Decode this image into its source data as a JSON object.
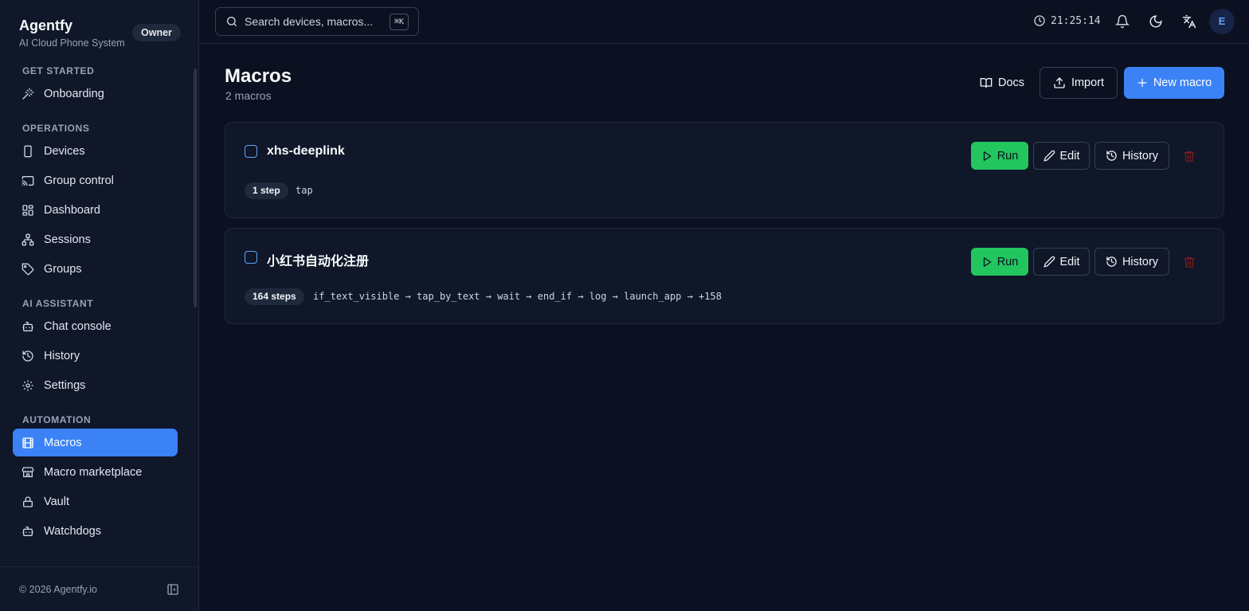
{
  "brand": {
    "name": "Agentfy",
    "subtitle": "AI Cloud Phone System",
    "role_badge": "Owner"
  },
  "sidebar": {
    "sections": [
      {
        "title": "GET STARTED",
        "items": [
          {
            "label": "Onboarding",
            "icon": "wand-icon"
          }
        ]
      },
      {
        "title": "OPERATIONS",
        "items": [
          {
            "label": "Devices",
            "icon": "smartphone-icon"
          },
          {
            "label": "Group control",
            "icon": "cast-icon"
          },
          {
            "label": "Dashboard",
            "icon": "grid-icon"
          },
          {
            "label": "Sessions",
            "icon": "network-icon"
          },
          {
            "label": "Groups",
            "icon": "tag-icon"
          }
        ]
      },
      {
        "title": "AI ASSISTANT",
        "items": [
          {
            "label": "Chat console",
            "icon": "bot-icon"
          },
          {
            "label": "History",
            "icon": "history-icon"
          },
          {
            "label": "Settings",
            "icon": "gear-icon"
          }
        ]
      },
      {
        "title": "AUTOMATION",
        "items": [
          {
            "label": "Macros",
            "icon": "film-icon",
            "active": true
          },
          {
            "label": "Macro marketplace",
            "icon": "store-icon"
          },
          {
            "label": "Vault",
            "icon": "lock-icon"
          },
          {
            "label": "Watchdogs",
            "icon": "bot-icon"
          }
        ]
      }
    ],
    "footer": {
      "copyright": "© 2026 Agentfy.io"
    }
  },
  "topbar": {
    "search_placeholder": "Search devices, macros...",
    "shortcut": "⌘K",
    "time": "21:25:14",
    "avatar_initial": "E"
  },
  "page": {
    "title": "Macros",
    "subtitle": "2 macros",
    "docs_label": "Docs",
    "import_label": "Import",
    "new_label": "New macro"
  },
  "macros": [
    {
      "name": "xhs-deeplink",
      "steps_badge": "1 step",
      "sequence": "tap"
    },
    {
      "name": "小红书自动化注册",
      "steps_badge": "164 steps",
      "sequence": "if_text_visible → tap_by_text → wait → end_if → log → launch_app → +158"
    }
  ],
  "card_actions": {
    "run": "Run",
    "edit": "Edit",
    "history": "History"
  },
  "colors": {
    "accent": "#3b82f6",
    "run": "#22c55e",
    "background": "#0b1120",
    "sidebar": "#0f1729",
    "trash": "#7f1d1d"
  }
}
